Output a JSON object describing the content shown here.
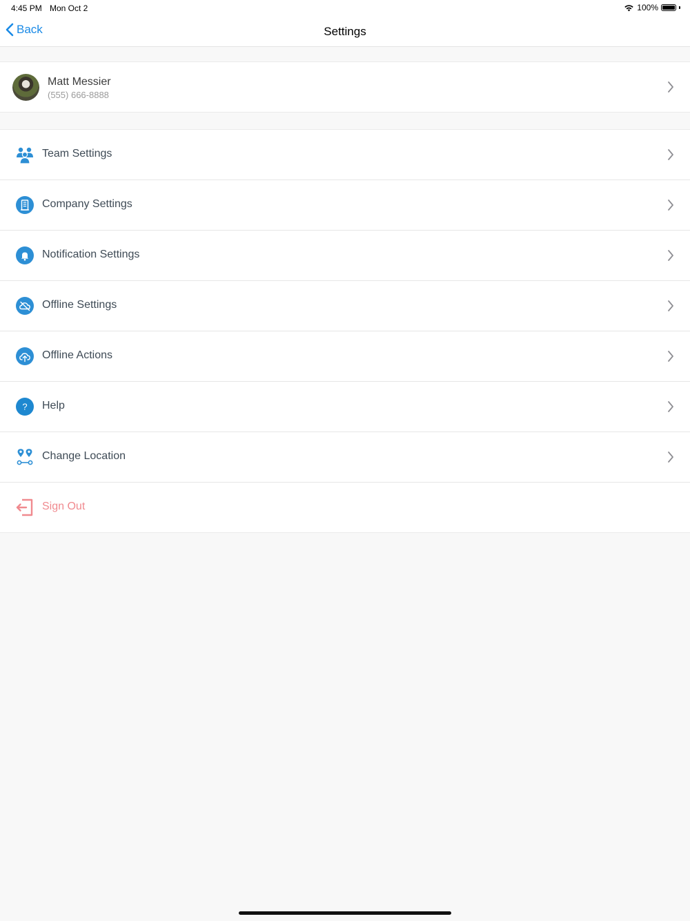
{
  "status_bar": {
    "time": "4:45 PM",
    "date": "Mon Oct 2",
    "battery_text": "100%",
    "icons": [
      "wifi-icon",
      "battery-icon"
    ]
  },
  "nav": {
    "back_label": "Back",
    "title": "Settings"
  },
  "profile": {
    "name": "Matt Messier",
    "phone": "(555) 666-8888"
  },
  "menu": [
    {
      "label": "Team Settings",
      "icon": "team-icon"
    },
    {
      "label": "Company Settings",
      "icon": "building-icon"
    },
    {
      "label": "Notification Settings",
      "icon": "bell-icon"
    },
    {
      "label": "Offline Settings",
      "icon": "cloud-off-icon"
    },
    {
      "label": "Offline Actions",
      "icon": "cloud-upload-icon"
    },
    {
      "label": "Help",
      "icon": "help-icon"
    },
    {
      "label": "Change Location",
      "icon": "location-pins-icon"
    },
    {
      "label": "Sign Out",
      "icon": "sign-out-icon"
    }
  ],
  "colors": {
    "accent": "#1a8ae6",
    "icon_blue": "#2d8fd5",
    "sign_out": "#f08a8f",
    "background": "#f8f8f8"
  }
}
